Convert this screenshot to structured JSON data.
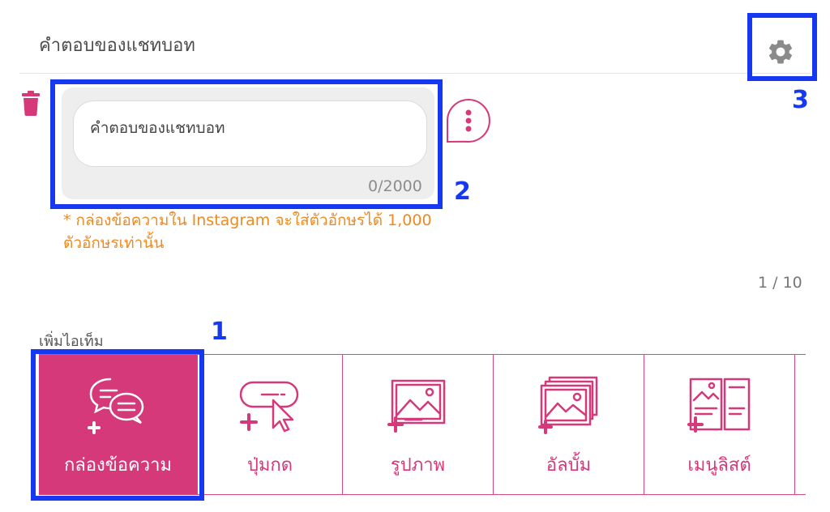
{
  "header": {
    "title": "คำตอบของแชทบอท"
  },
  "message_editor": {
    "input_value": "คำตอบของแชทบอท",
    "counter": "0/2000",
    "note": "* กล่องข้อความใน Instagram จะใส่ตัวอักษรได้ 1,000 ตัวอักษรเท่านั้น"
  },
  "pager": "1 / 10",
  "add_items": {
    "label": "เพิ่มไอเท็ม",
    "tiles": [
      {
        "label": "กล่องข้อความ",
        "icon": "chat-bubbles-plus-icon",
        "active": true
      },
      {
        "label": "ปุ่มกด",
        "icon": "button-cursor-plus-icon",
        "active": false
      },
      {
        "label": "รูปภาพ",
        "icon": "image-plus-icon",
        "active": false
      },
      {
        "label": "อัลบั้ม",
        "icon": "album-plus-icon",
        "active": false
      },
      {
        "label": "เมนูลิสต์",
        "icon": "menu-list-plus-icon",
        "active": false
      }
    ]
  },
  "callouts": {
    "one": "1",
    "two": "2",
    "three": "3"
  },
  "colors": {
    "accent": "#d6397a",
    "highlight": "#1638f0",
    "note": "#ee8a20"
  }
}
